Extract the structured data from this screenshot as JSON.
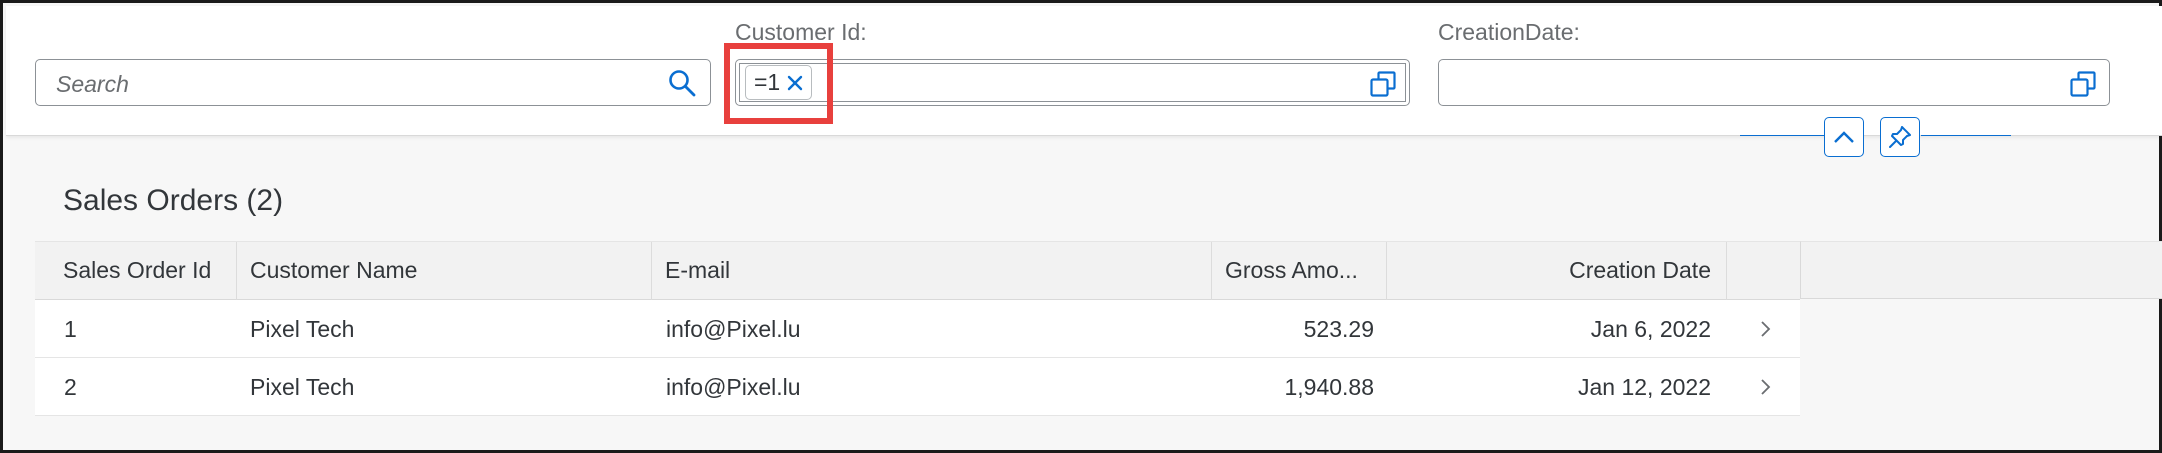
{
  "filter_bar": {
    "search": {
      "placeholder": "Search",
      "icon": "search-icon"
    },
    "customer_id": {
      "label": "Customer Id:",
      "token": "=1",
      "value_help_icon": "value-help-icon"
    },
    "creation_date": {
      "label": "CreationDate:",
      "value": "",
      "value_help_icon": "value-help-icon"
    },
    "collapse_icon": "chevron-up-icon",
    "pin_icon": "pin-icon"
  },
  "table": {
    "title": "Sales Orders (2)",
    "columns": [
      "Sales Order Id",
      "Customer Name",
      "E-mail",
      "Gross Amo...",
      "Creation Date"
    ],
    "rows": [
      {
        "id": "1",
        "customer": "Pixel Tech",
        "email": "info@Pixel.lu",
        "gross": "523.29",
        "date": "Jan 6, 2022"
      },
      {
        "id": "2",
        "customer": "Pixel Tech",
        "email": "info@Pixel.lu",
        "gross": "1,940.88",
        "date": "Jan 12, 2022"
      }
    ]
  },
  "colors": {
    "accent": "#0a6ed1",
    "highlight": "#e8403d",
    "text": "#32363a"
  }
}
